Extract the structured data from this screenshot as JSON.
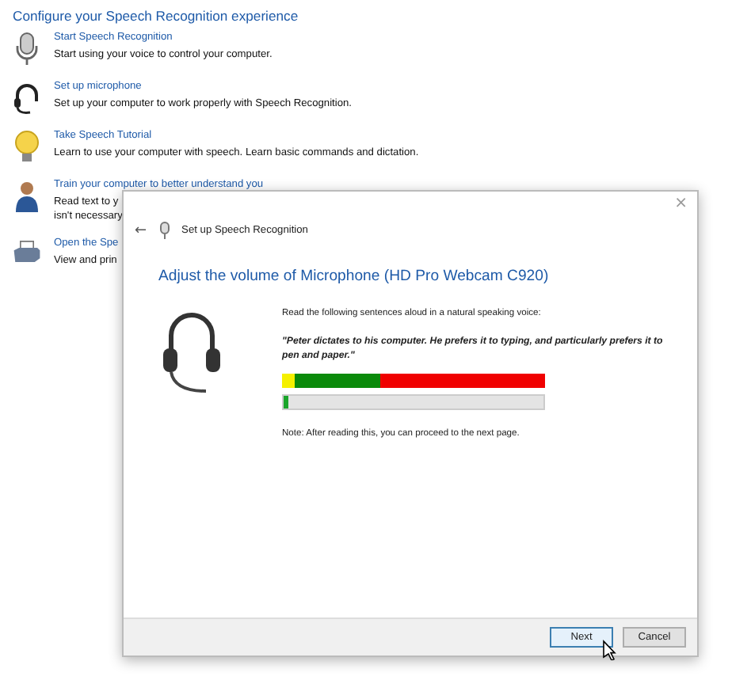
{
  "page": {
    "title": "Configure your Speech Recognition experience"
  },
  "items": [
    {
      "kind": "mic",
      "link": "Start Speech Recognition",
      "description": [
        "Start using your voice to control your computer."
      ]
    },
    {
      "kind": "headset",
      "link": "Set up microphone",
      "description": [
        "Set up your computer to work properly with Speech Recognition."
      ]
    },
    {
      "kind": "bulb",
      "link": "Take Speech Tutorial",
      "description": [
        "Learn to use your computer with speech.  Learn basic commands and dictation."
      ]
    },
    {
      "kind": "person",
      "link": "Train your computer to better understand you",
      "description": [
        "Read text to y",
        "isn't necessary"
      ]
    },
    {
      "kind": "printer",
      "link": "Open the Spe",
      "description": [
        "View and prin"
      ]
    }
  ],
  "dialog": {
    "title": "Set up Speech Recognition",
    "close": "×",
    "back": "←",
    "heading": "Adjust the volume of Microphone (HD Pro Webcam C920)",
    "instruction": "Read the following sentences aloud in a natural speaking voice:",
    "sample": "\"Peter dictates to his computer. He prefers it to typing, and particularly prefers it to pen and paper.\"",
    "meter": {
      "level": 0.02
    },
    "note": "Note: After reading this, you can proceed to the next page.",
    "buttons": [
      {
        "label": "Next",
        "default": true
      },
      {
        "label": "Cancel",
        "default": false
      }
    ]
  }
}
